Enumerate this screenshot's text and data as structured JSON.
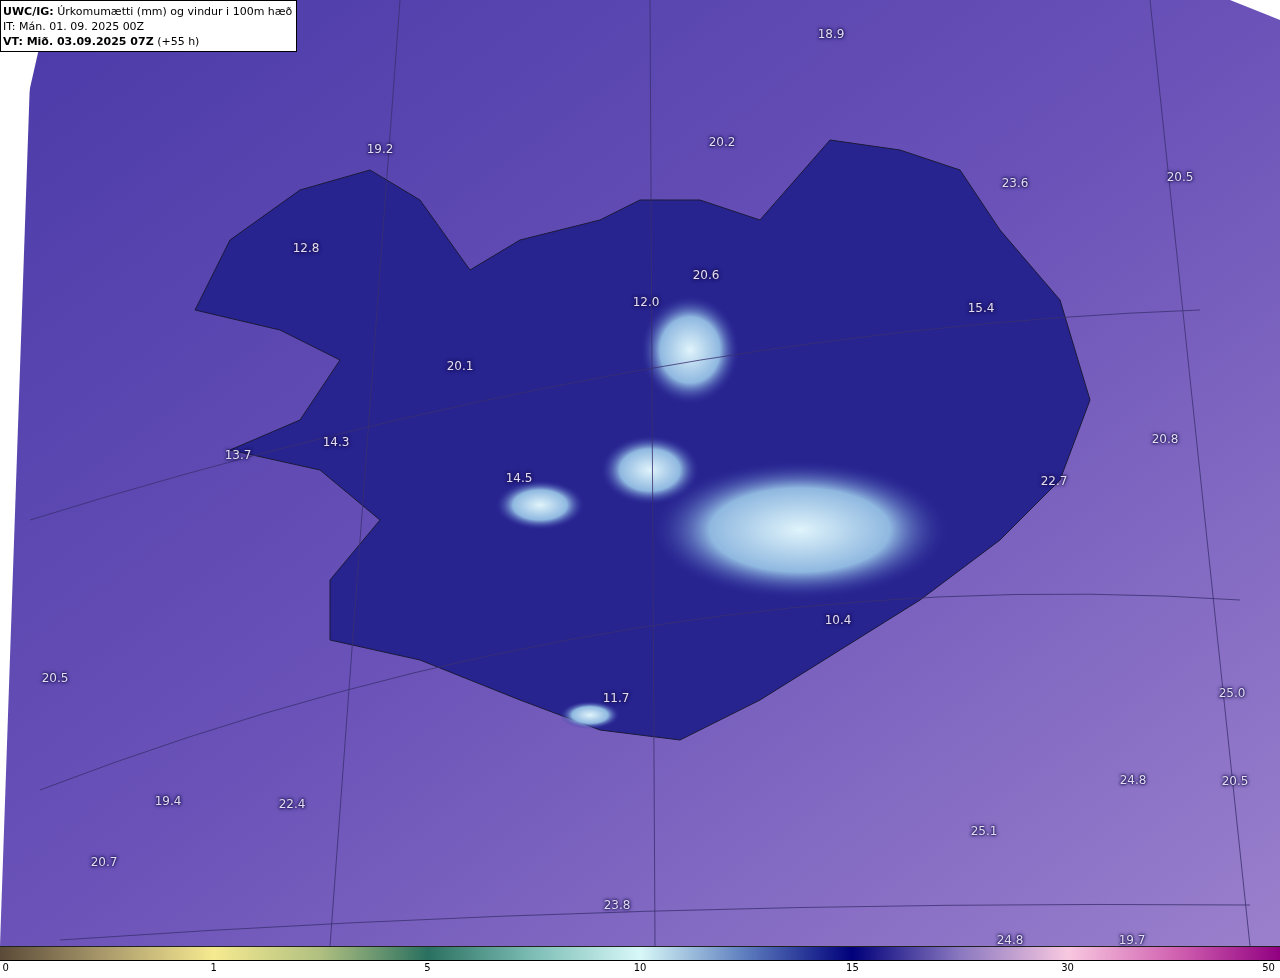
{
  "header": {
    "product": "UWC/IG:",
    "title": "Úrkomumætti (mm) og vindur i 100m hæð",
    "issue_time": "IT: Mán. 01. 09. 2025 00Z",
    "valid_label": "VT: Mið. 03.09.2025 07Z",
    "valid_offset": "(+55 h)"
  },
  "map_values": [
    "18.9",
    "20.2",
    "19.2",
    "23.6",
    "20.5",
    "12.8",
    "20.6",
    "12.0",
    "15.4",
    "20.1",
    "20.8",
    "13.7",
    "14.3",
    "14.5",
    "22.7",
    "10.4",
    "20.5",
    "11.7",
    "25.0",
    "24.8",
    "20.5",
    "19.4",
    "22.4",
    "25.1",
    "20.7",
    "23.8",
    "24.8",
    "19.7"
  ],
  "colorbar": {
    "ticks": [
      "0",
      "1",
      "5",
      "10",
      "15",
      "30",
      "50"
    ]
  }
}
